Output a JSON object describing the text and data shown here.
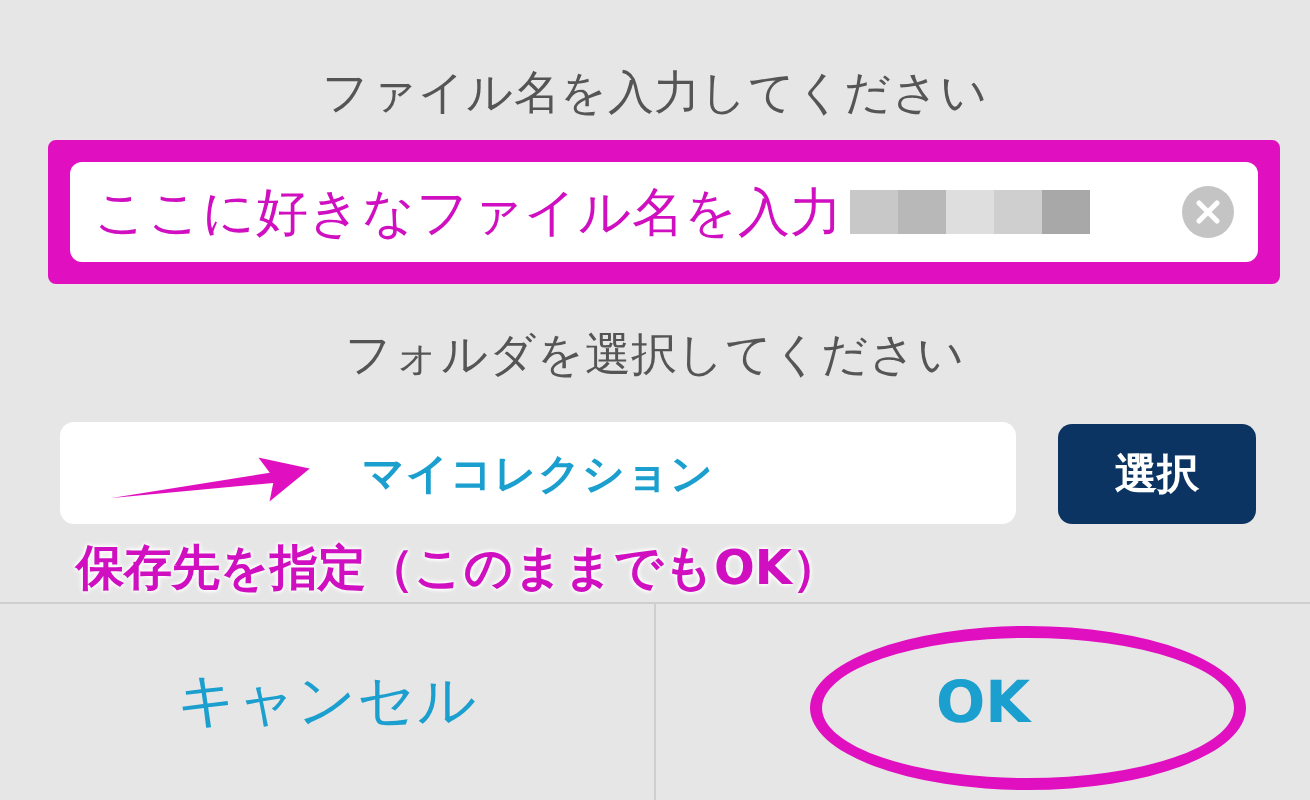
{
  "dialog": {
    "filename_label": "ファイル名を入力してください",
    "folder_label": "フォルダを選択してください",
    "folder_value": "マイコレクション",
    "select_button": "選択",
    "buttons": [
      {
        "label": "キャンセル",
        "kind": "cancel"
      },
      {
        "label": "OK",
        "kind": "ok"
      }
    ]
  },
  "annotations": {
    "filename_note": "ここに好きなファイル名を入力",
    "folder_note": "保存先を指定（このままでも**OK**）"
  }
}
